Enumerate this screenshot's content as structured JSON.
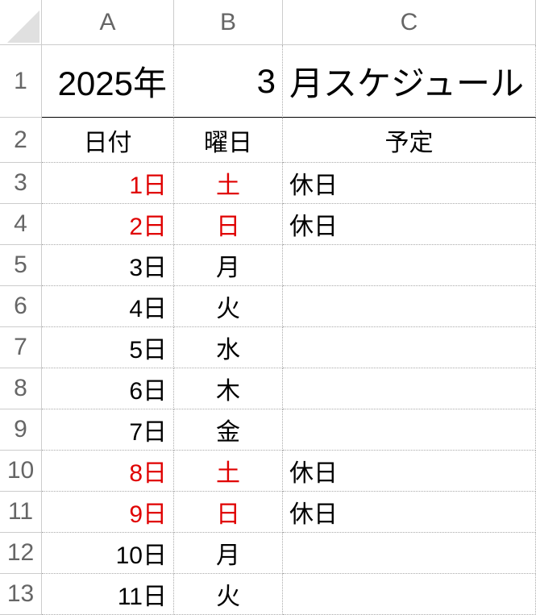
{
  "columns": [
    "A",
    "B",
    "C"
  ],
  "rowNumbers": [
    "1",
    "2",
    "3",
    "4",
    "5",
    "6",
    "7",
    "8",
    "9",
    "10",
    "11",
    "12",
    "13"
  ],
  "titleRow": {
    "year": "2025年",
    "month": "3",
    "label": "月スケジュール"
  },
  "headers": {
    "date": "日付",
    "dow": "曜日",
    "plan": "予定"
  },
  "rows": [
    {
      "date": "1日",
      "dow": "土",
      "plan": "休日",
      "weekend": true
    },
    {
      "date": "2日",
      "dow": "日",
      "plan": "休日",
      "weekend": true
    },
    {
      "date": "3日",
      "dow": "月",
      "plan": "",
      "weekend": false
    },
    {
      "date": "4日",
      "dow": "火",
      "plan": "",
      "weekend": false
    },
    {
      "date": "5日",
      "dow": "水",
      "plan": "",
      "weekend": false
    },
    {
      "date": "6日",
      "dow": "木",
      "plan": "",
      "weekend": false
    },
    {
      "date": "7日",
      "dow": "金",
      "plan": "",
      "weekend": false
    },
    {
      "date": "8日",
      "dow": "土",
      "plan": "休日",
      "weekend": true
    },
    {
      "date": "9日",
      "dow": "日",
      "plan": "休日",
      "weekend": true
    },
    {
      "date": "10日",
      "dow": "月",
      "plan": "",
      "weekend": false
    },
    {
      "date": "11日",
      "dow": "火",
      "plan": "",
      "weekend": false
    }
  ]
}
